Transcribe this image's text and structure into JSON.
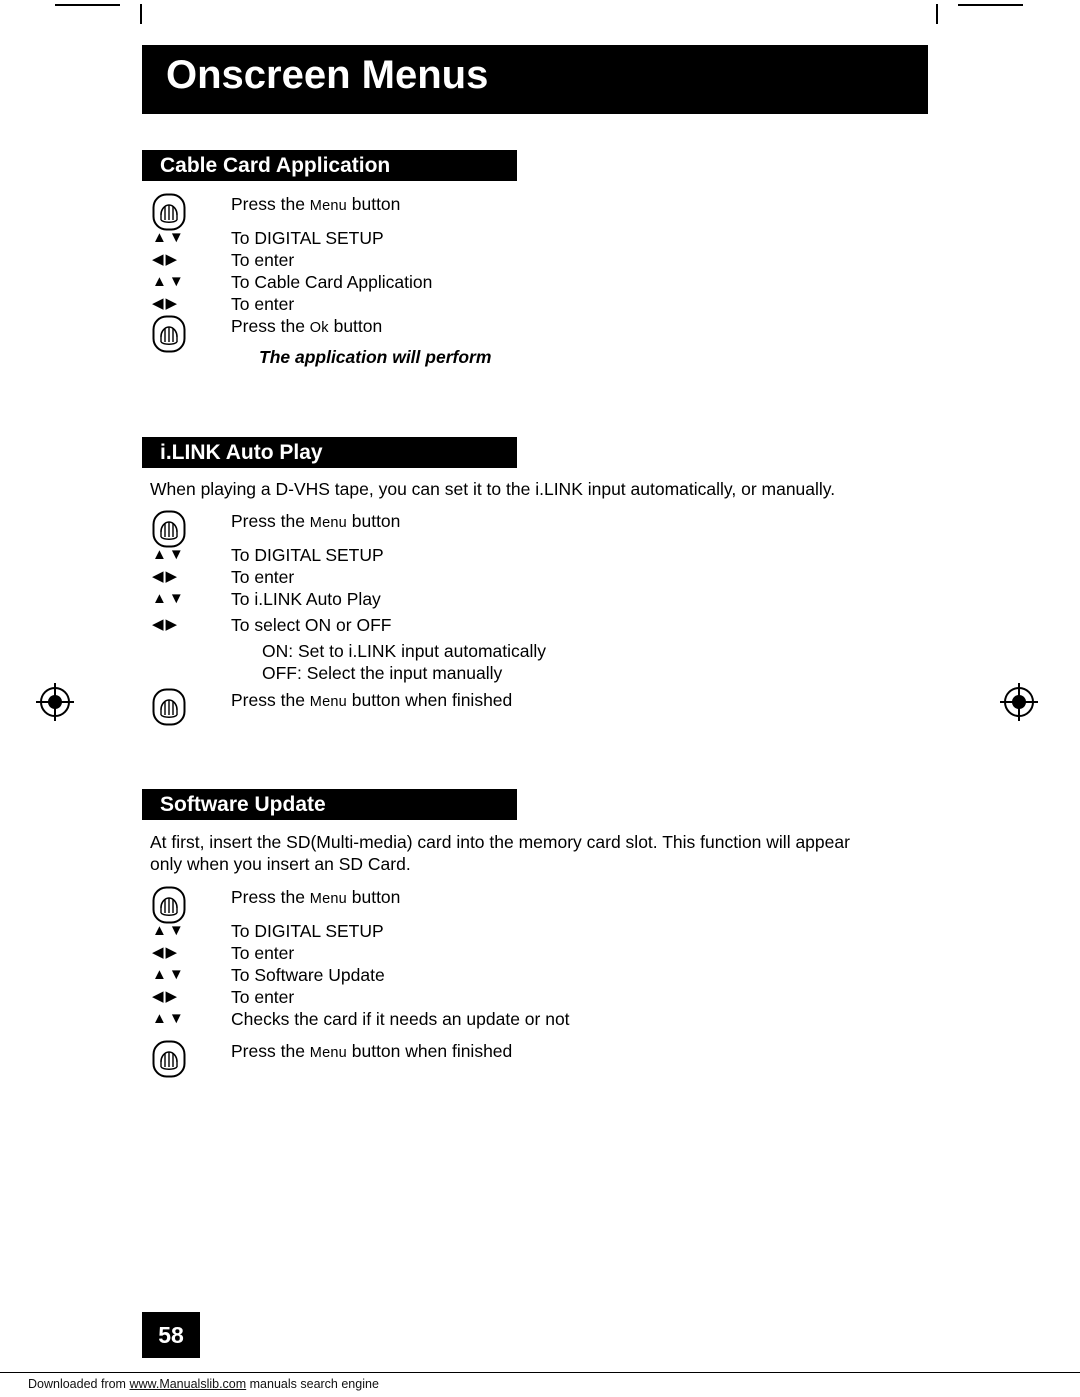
{
  "page": {
    "title": "Onscreen Menus",
    "number": "58"
  },
  "sections": [
    {
      "heading": "Cable Card Application",
      "intro": "",
      "steps": [
        {
          "icon": "remote-button-icon",
          "arrows": "",
          "text_pre": "Press the ",
          "text_sc": "Menu",
          "text_post": " button"
        },
        {
          "icon": "",
          "arrows": "up-down",
          "text_pre": "To DIGITAL SETUP",
          "text_sc": "",
          "text_post": ""
        },
        {
          "icon": "",
          "arrows": "left-right",
          "text_pre": "To enter",
          "text_sc": "",
          "text_post": ""
        },
        {
          "icon": "",
          "arrows": "up-down",
          "text_pre": "To Cable Card Application",
          "text_sc": "",
          "text_post": ""
        },
        {
          "icon": "",
          "arrows": "left-right",
          "text_pre": "To enter",
          "text_sc": "",
          "text_post": ""
        },
        {
          "icon": "remote-button-icon",
          "arrows": "",
          "text_pre": "Press the ",
          "text_sc": "Ok",
          "text_post": " button"
        }
      ],
      "note": "The application will perform"
    },
    {
      "heading": "i.LINK Auto Play",
      "intro": "When playing a D-VHS tape, you can set it to the i.LINK input automatically, or manually.",
      "steps": [
        {
          "icon": "remote-button-icon",
          "arrows": "",
          "text_pre": "Press the ",
          "text_sc": "Menu",
          "text_post": " button"
        },
        {
          "icon": "",
          "arrows": "up-down",
          "text_pre": "To DIGITAL SETUP",
          "text_sc": "",
          "text_post": ""
        },
        {
          "icon": "",
          "arrows": "left-right",
          "text_pre": "To enter",
          "text_sc": "",
          "text_post": ""
        },
        {
          "icon": "",
          "arrows": "up-down",
          "text_pre": "To i.LINK Auto Play",
          "text_sc": "",
          "text_post": ""
        },
        {
          "icon": "",
          "arrows": "left-right",
          "text_pre": "To select ON or OFF",
          "text_sc": "",
          "text_post": ""
        }
      ],
      "sub_options": [
        "ON:  Set to i.LINK input automatically",
        "OFF:  Select the input manually"
      ],
      "final": {
        "icon": "remote-button-icon",
        "text_pre": "Press the ",
        "text_sc": "Menu",
        "text_post": " button when finished"
      }
    },
    {
      "heading": "Software Update",
      "intro_line1": "At first, insert the SD(Multi-media) card into the memory card slot.  This function will appear",
      "intro_line2": "only when you insert an SD Card.",
      "steps": [
        {
          "icon": "remote-button-icon",
          "arrows": "",
          "text_pre": "Press the ",
          "text_sc": "Menu",
          "text_post": " button"
        },
        {
          "icon": "",
          "arrows": "up-down",
          "text_pre": "To DIGITAL SETUP",
          "text_sc": "",
          "text_post": ""
        },
        {
          "icon": "",
          "arrows": "left-right",
          "text_pre": "To enter",
          "text_sc": "",
          "text_post": ""
        },
        {
          "icon": "",
          "arrows": "up-down",
          "text_pre": "To Software Update",
          "text_sc": "",
          "text_post": ""
        },
        {
          "icon": "",
          "arrows": "left-right",
          "text_pre": "To enter",
          "text_sc": "",
          "text_post": ""
        },
        {
          "icon": "",
          "arrows": "up-down",
          "text_pre": "Checks the card if it needs an update or not",
          "text_sc": "",
          "text_post": ""
        }
      ],
      "final": {
        "icon": "remote-button-icon",
        "text_pre": "Press the ",
        "text_sc": "Menu",
        "text_post": " button when finished"
      }
    }
  ],
  "footer": {
    "prefix": "Downloaded from ",
    "link": "www.Manualslib.com",
    "suffix": " manuals search engine"
  },
  "glyphs": {
    "up_down": "▲▼",
    "left_right": "◀▶"
  }
}
